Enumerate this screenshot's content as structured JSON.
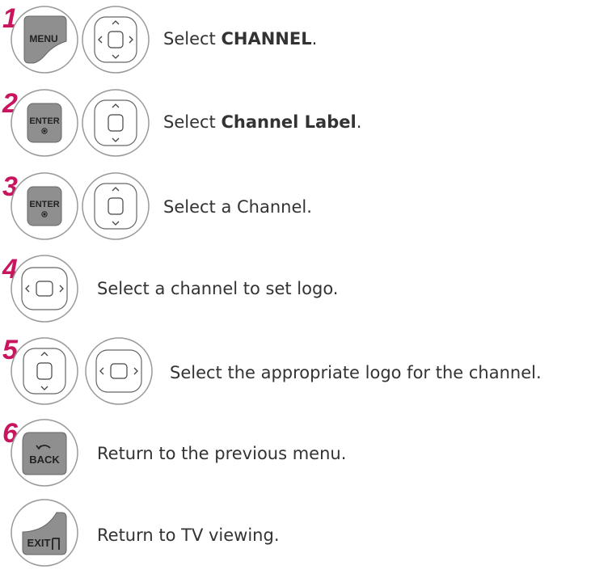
{
  "steps": [
    {
      "number": "1",
      "buttons": [
        "menu-button",
        "nav-left-right-up-down"
      ],
      "text_pre": "Select ",
      "text_bold": "CHANNEL",
      "text_post": "."
    },
    {
      "number": "2",
      "buttons": [
        "enter-button",
        "nav-up-down"
      ],
      "text_pre": "Select ",
      "text_bold": "Channel Label",
      "text_post": "."
    },
    {
      "number": "3",
      "buttons": [
        "enter-button",
        "nav-up-down"
      ],
      "text_pre": "Select a Channel.",
      "text_bold": "",
      "text_post": ""
    },
    {
      "number": "4",
      "buttons": [
        "nav-left-right"
      ],
      "text_pre": "Select a channel to set logo.",
      "text_bold": "",
      "text_post": ""
    },
    {
      "number": "5",
      "buttons": [
        "nav-up-down",
        "nav-left-right"
      ],
      "text_pre": "Select the appropriate logo for the channel.",
      "text_bold": "",
      "text_post": ""
    },
    {
      "number": "6",
      "buttons": [
        "back-button"
      ],
      "text_pre": "Return to the previous menu.",
      "text_bold": "",
      "text_post": ""
    },
    {
      "number": "",
      "buttons": [
        "exit-button"
      ],
      "text_pre": "Return to TV viewing.",
      "text_bold": "",
      "text_post": ""
    }
  ],
  "keys": {
    "menu": "MENU",
    "enter": "ENTER",
    "back": "BACK",
    "exit": "EXIT"
  },
  "colors": {
    "step_number": "#c8155e",
    "button_face": "#8f8f8f",
    "button_outline": "#999999"
  }
}
